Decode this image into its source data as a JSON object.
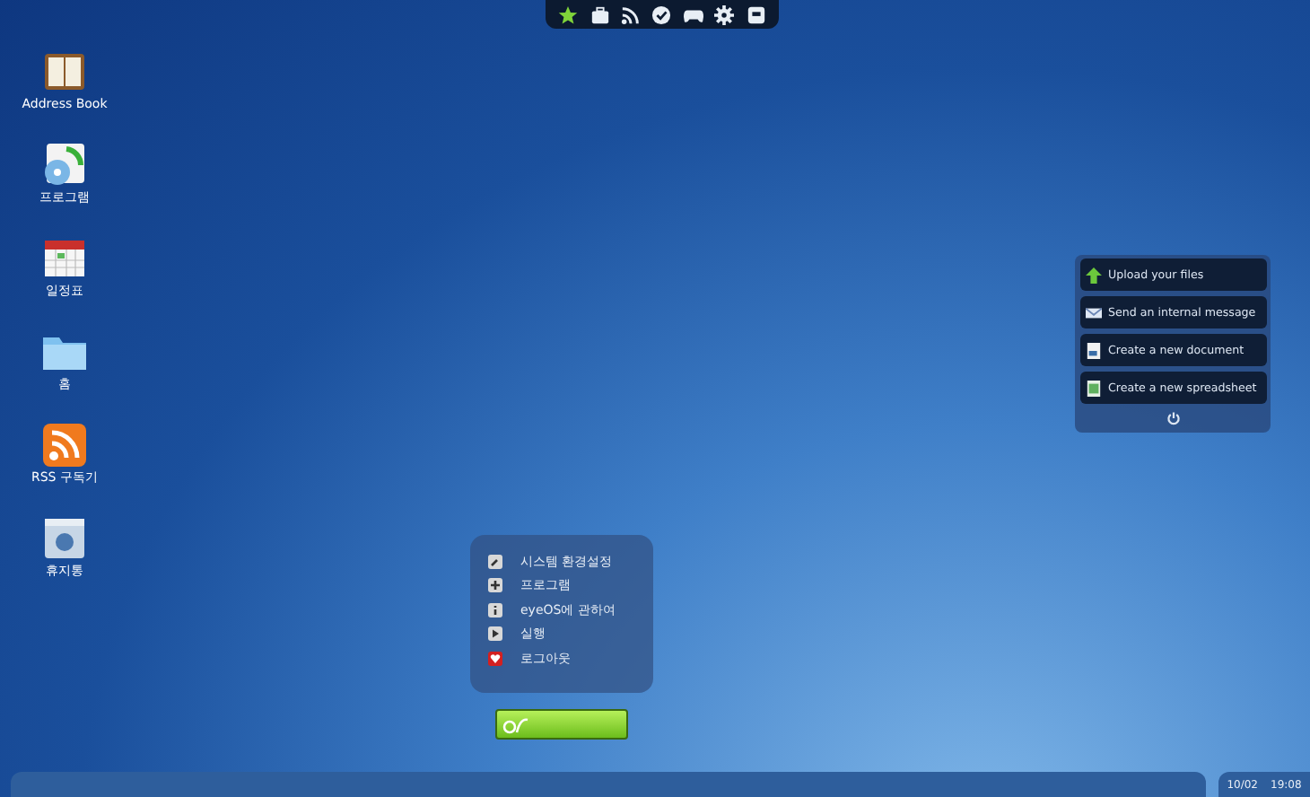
{
  "desktop_icons": [
    {
      "kind": "book",
      "label": "Address Book"
    },
    {
      "kind": "programs",
      "label": "프로그램"
    },
    {
      "kind": "calendar",
      "label": "일정표"
    },
    {
      "kind": "folder",
      "label": "홈"
    },
    {
      "kind": "rss",
      "label": "RSS 구독기"
    },
    {
      "kind": "trash",
      "label": "휴지통"
    }
  ],
  "top_toolbar": [
    {
      "kind": "star",
      "selected": true
    },
    {
      "kind": "briefcase",
      "selected": false
    },
    {
      "kind": "feed",
      "selected": false
    },
    {
      "kind": "check",
      "selected": false
    },
    {
      "kind": "gamepad",
      "selected": false
    },
    {
      "kind": "gear",
      "selected": false
    },
    {
      "kind": "tray",
      "selected": false
    }
  ],
  "actions_panel": {
    "items": [
      {
        "kind": "upload",
        "label": "Upload your files"
      },
      {
        "kind": "mail",
        "label": "Send an internal message"
      },
      {
        "kind": "document",
        "label": "Create a new document"
      },
      {
        "kind": "spreadsheet",
        "label": "Create a new spreadsheet"
      }
    ]
  },
  "start_menu": {
    "items": [
      {
        "kind": "wrench",
        "label": "시스템 환경설정"
      },
      {
        "kind": "plus",
        "label": "프로그램"
      },
      {
        "kind": "info",
        "label": "eyeOS에 관하여"
      },
      {
        "kind": "play",
        "label": "실행"
      },
      {
        "kind": "logout",
        "label": "로그아웃"
      }
    ]
  },
  "taskbar": {
    "date": "10/02",
    "time": "19:08"
  }
}
